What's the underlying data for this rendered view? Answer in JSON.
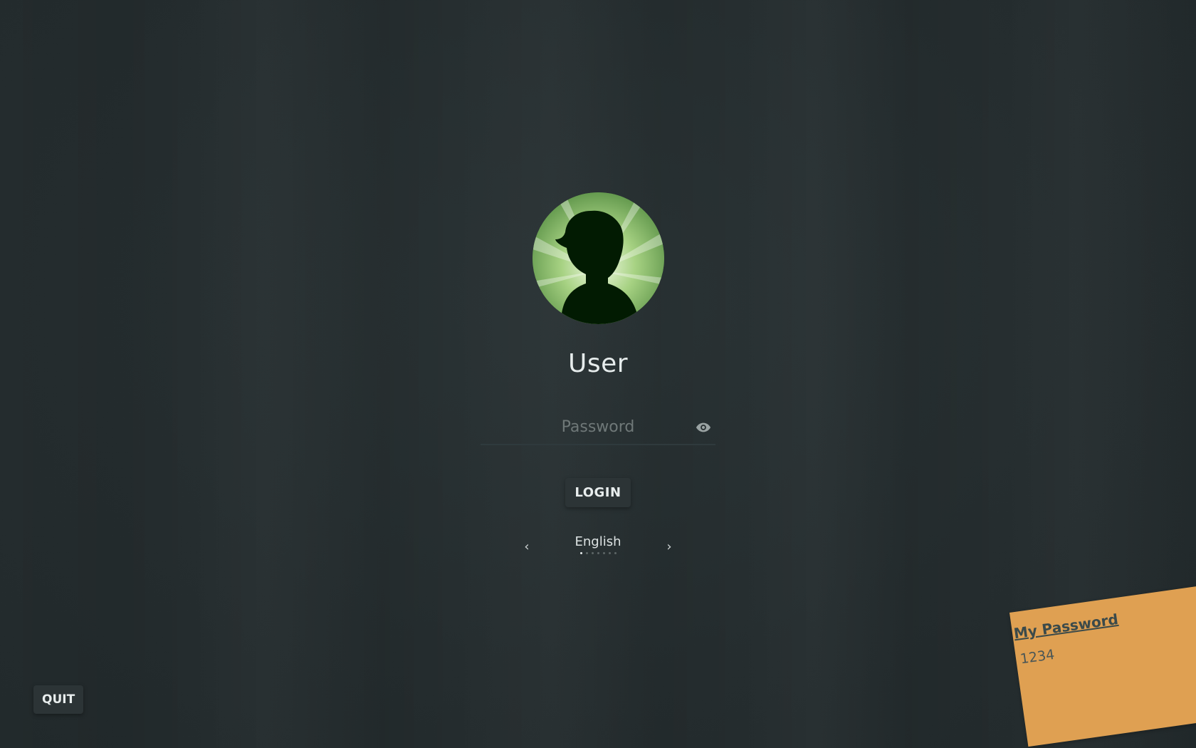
{
  "user": {
    "name": "User",
    "avatar": "user-avatar-silhouette"
  },
  "password": {
    "placeholder": "Password",
    "value": "",
    "reveal_icon": "eye-icon"
  },
  "login_button": "LOGIN",
  "language": {
    "current": "English",
    "prev_icon": "chevron-left-icon",
    "next_icon": "chevron-right-icon",
    "prev_glyph": "‹",
    "next_glyph": "›",
    "page_count": 7,
    "active_index": 0
  },
  "quit_button": "QUIT",
  "sticky_note": {
    "title": "My Password",
    "body": "1234",
    "color": "#dfa052"
  },
  "colors": {
    "background": "#252d2f",
    "button_bg": "#2c3436",
    "text": "#e6ecec"
  }
}
